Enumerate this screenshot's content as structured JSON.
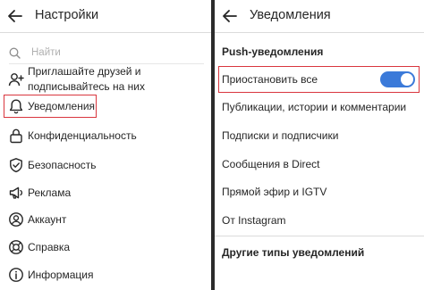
{
  "left": {
    "title": "Настройки",
    "search_placeholder": "Найти",
    "items": [
      {
        "label": "Приглашайте друзей и подписывайтесь на них",
        "icon": "add-user-icon"
      },
      {
        "label": "Уведомления",
        "icon": "bell-icon"
      },
      {
        "label": "Конфиденциальность",
        "icon": "lock-icon"
      },
      {
        "label": "Безопасность",
        "icon": "shield-icon"
      },
      {
        "label": "Реклама",
        "icon": "megaphone-icon"
      },
      {
        "label": "Аккаунт",
        "icon": "account-icon"
      },
      {
        "label": "Справка",
        "icon": "help-icon"
      },
      {
        "label": "Информация",
        "icon": "info-icon"
      }
    ]
  },
  "right": {
    "title": "Уведомления",
    "push_section": "Push-уведомления",
    "pause_all": "Приостановить все",
    "pause_all_enabled": true,
    "items": [
      "Публикации, истории и комментарии",
      "Подписки и подписчики",
      "Сообщения в Direct",
      "Прямой эфир и IGTV",
      "От Instagram"
    ],
    "other_section": "Другие типы уведомлений"
  },
  "colors": {
    "highlight": "#d9363e",
    "toggle_on": "#3b7ad9",
    "text": "#262626",
    "divider": "#2b2b2b"
  }
}
